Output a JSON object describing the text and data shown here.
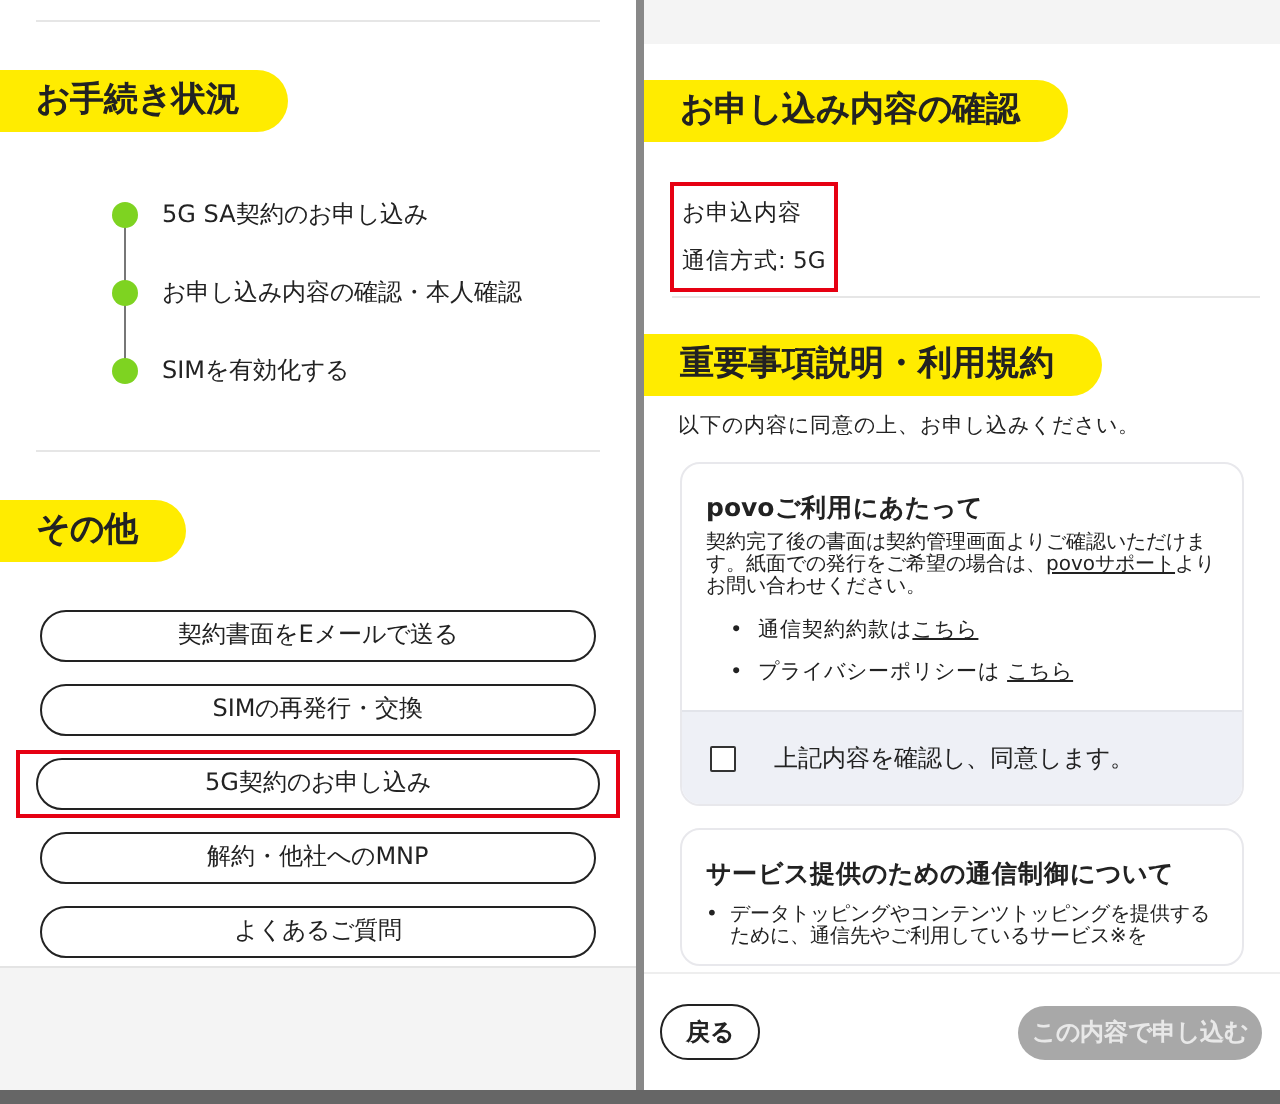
{
  "status_panel": {
    "heading": "お手続き状況",
    "steps": [
      {
        "label": "5G SA契約のお申し込み",
        "done": true
      },
      {
        "label": "お申し込み内容の確認・本人確認",
        "done": true
      },
      {
        "label": "SIMを有効化する",
        "done": true
      }
    ]
  },
  "other": {
    "heading": "その他",
    "buttons": [
      {
        "label": "契約書面をEメールで送る",
        "highlighted": false
      },
      {
        "label": "SIMの再発行・交換",
        "highlighted": false
      },
      {
        "label": "5G契約のお申し込み",
        "highlighted": true
      },
      {
        "label": "解約・他社へのMNP",
        "highlighted": false
      },
      {
        "label": "よくあるご質問",
        "highlighted": false
      }
    ]
  },
  "confirm": {
    "heading": "お申し込み内容の確認",
    "summary": {
      "title": "お申込内容",
      "line": "通信方式: 5G",
      "highlighted": true
    }
  },
  "terms": {
    "heading": "重要事項説明・利用規約",
    "intro": "以下の内容に同意の上、お申し込みください。",
    "cards": [
      {
        "title": "povoご利用にあたって",
        "body_before": "契約完了後の書面は契約管理画面よりご確認いただけます。紙面での発行をご希望の場合は、",
        "body_link": "povoサポート",
        "body_after": "よりお問い合わせください。",
        "bullets": [
          {
            "marker": "•",
            "text": "通信契約約款は",
            "link": "こちら"
          },
          {
            "marker": "•",
            "text": "プライバシーポリシーは ",
            "link": "こちら"
          }
        ],
        "agreement": {
          "label": "上記内容を確認し、同意します。",
          "checked": false
        }
      },
      {
        "title": "サービス提供のための通信制御について",
        "bullets": [
          {
            "marker": "•",
            "text": "データトッピングやコンテンツトッピングを提供するために、通信先やご利用しているサービス※を"
          }
        ]
      }
    ]
  },
  "footer": {
    "back": "戻る",
    "submit": {
      "label": "この内容で申し込む",
      "disabled": true
    }
  }
}
